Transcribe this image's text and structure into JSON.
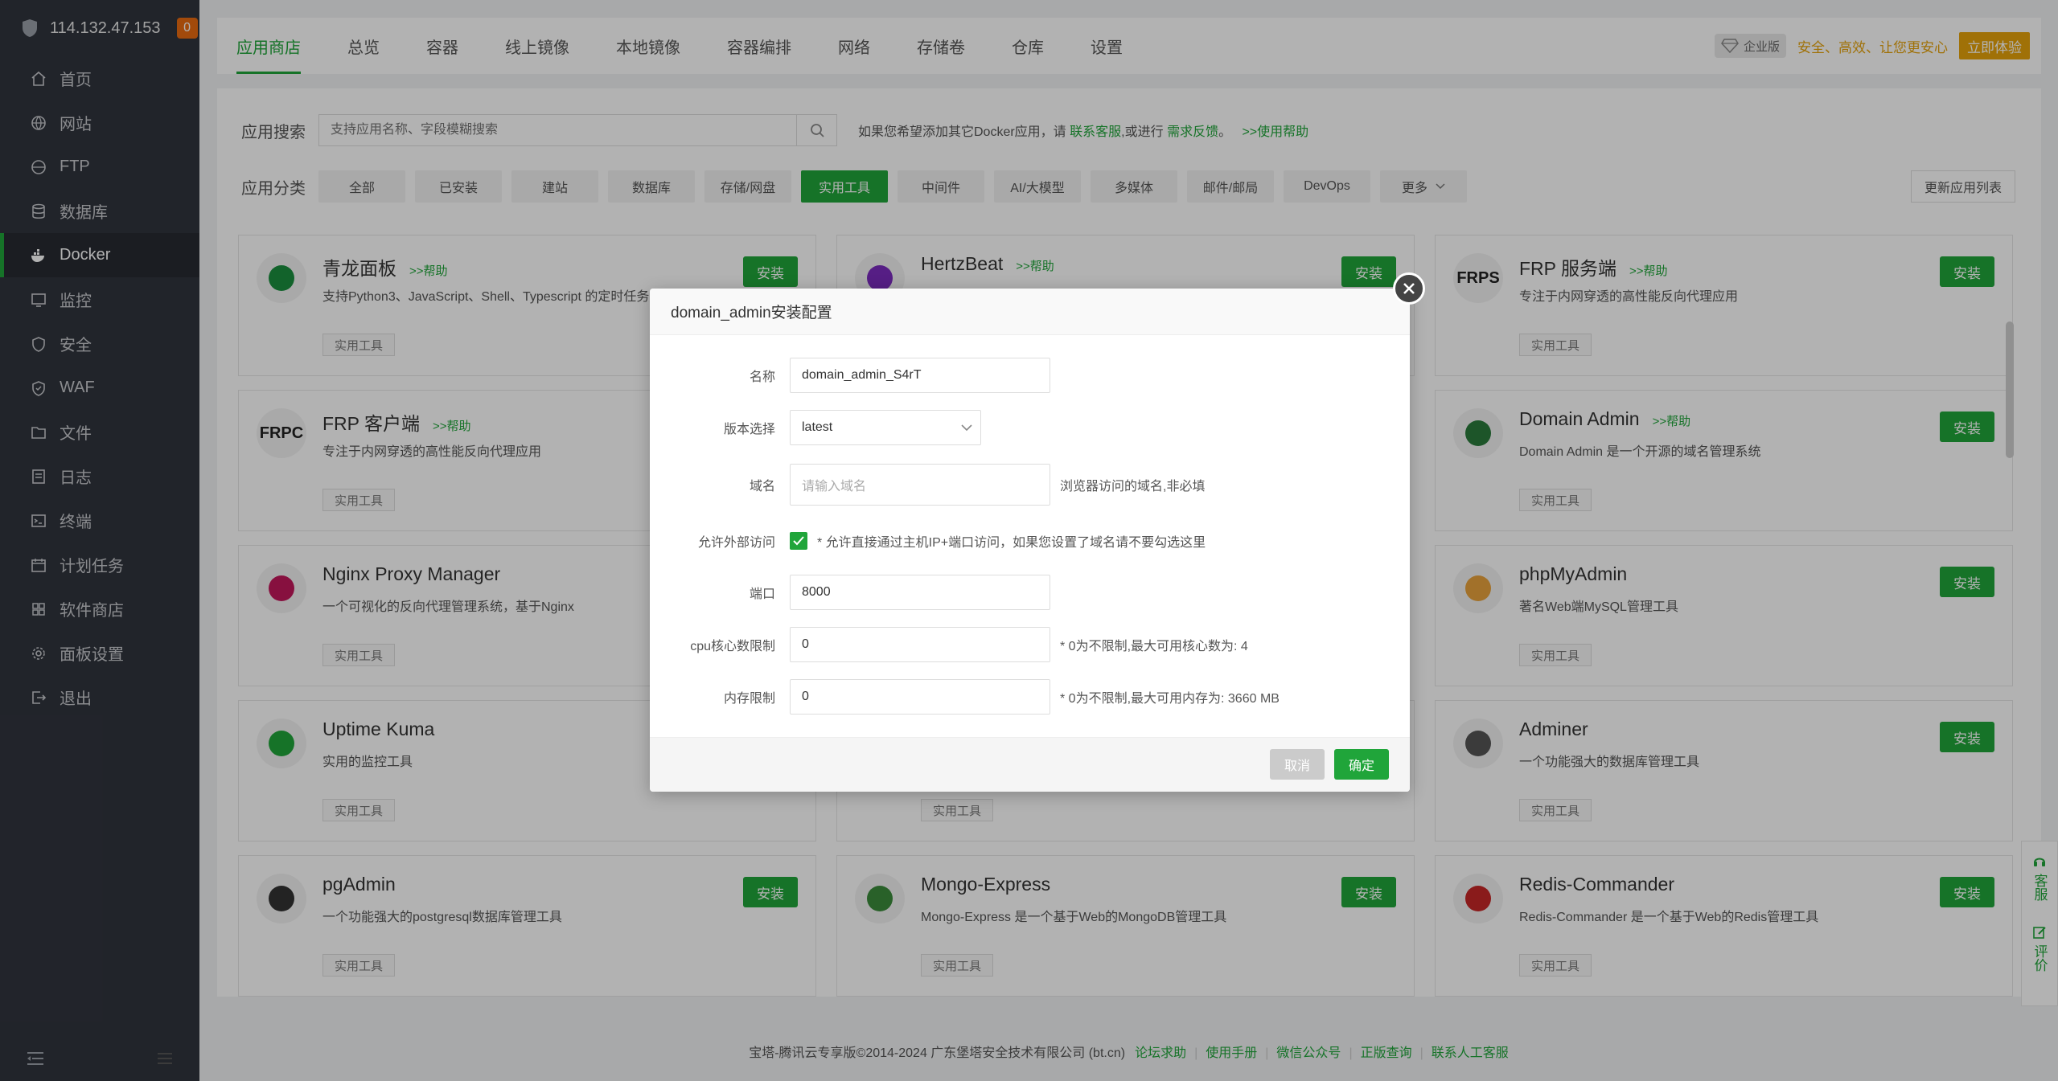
{
  "sidebar": {
    "ip": "114.132.47.153",
    "badge": "0",
    "items": [
      {
        "label": "首页",
        "icon": "home-icon"
      },
      {
        "label": "网站",
        "icon": "globe-icon"
      },
      {
        "label": "FTP",
        "icon": "ftp-icon"
      },
      {
        "label": "数据库",
        "icon": "database-icon"
      },
      {
        "label": "Docker",
        "icon": "docker-icon"
      },
      {
        "label": "监控",
        "icon": "monitor-icon"
      },
      {
        "label": "安全",
        "icon": "shield-icon"
      },
      {
        "label": "WAF",
        "icon": "waf-icon"
      },
      {
        "label": "文件",
        "icon": "folder-icon"
      },
      {
        "label": "日志",
        "icon": "log-icon"
      },
      {
        "label": "终端",
        "icon": "terminal-icon"
      },
      {
        "label": "计划任务",
        "icon": "calendar-icon"
      },
      {
        "label": "软件商店",
        "icon": "store-icon"
      },
      {
        "label": "面板设置",
        "icon": "gear-icon"
      },
      {
        "label": "退出",
        "icon": "logout-icon"
      }
    ]
  },
  "tabs": [
    "应用商店",
    "总览",
    "容器",
    "线上镜像",
    "本地镜像",
    "容器编排",
    "网络",
    "存储卷",
    "仓库",
    "设置"
  ],
  "enterprise": {
    "badge": "企业版",
    "text": "安全、高效、让您更安心",
    "button": "立即体验"
  },
  "search": {
    "label": "应用搜索",
    "placeholder": "支持应用名称、字段模糊搜索",
    "hint_pre": "如果您希望添加其它Docker应用，请",
    "hint_link1": "联系客服",
    "hint_mid": ",或进行",
    "hint_link2": "需求反馈",
    "hint_end": "。",
    "hint_help": ">>使用帮助"
  },
  "category": {
    "label": "应用分类",
    "items": [
      "全部",
      "已安装",
      "建站",
      "数据库",
      "存储/网盘",
      "实用工具",
      "中间件",
      "AI/大模型",
      "多媒体",
      "邮件/邮局",
      "DevOps",
      "更多"
    ],
    "refresh": "更新应用列表"
  },
  "apps": [
    {
      "title": "青龙面板",
      "help": ">>帮助",
      "desc": "支持Python3、JavaScript、Shell、Typescript 的定时任务",
      "tag": "实用工具",
      "logo": ""
    },
    {
      "title": "HertzBeat",
      "help": ">>帮助",
      "desc": "",
      "tag": "实用工具",
      "logo": ""
    },
    {
      "title": "FRP 服务端",
      "help": ">>帮助",
      "desc": "专注于内网穿透的高性能反向代理应用",
      "tag": "实用工具",
      "logo": "FRPS"
    },
    {
      "title": "FRP 客户端",
      "help": ">>帮助",
      "desc": "专注于内网穿透的高性能反向代理应用",
      "tag": "实用工具",
      "logo": "FRPC"
    },
    {
      "title": "Domain Admin",
      "help": ">>帮助",
      "desc": "Domain Admin 是一个开源的域名管理系统",
      "tag": "实用工具",
      "logo": ""
    },
    {
      "title": "Nginx Proxy Manager",
      "help": "",
      "desc": "一个可视化的反向代理管理系统，基于Nginx",
      "tag": "实用工具",
      "logo": ""
    },
    {
      "title": "phpMyAdmin",
      "help": "",
      "desc": "著名Web端MySQL管理工具",
      "tag": "实用工具",
      "logo": ""
    },
    {
      "title": "Uptime Kuma",
      "help": "",
      "desc": "实用的监控工具",
      "tag": "实用工具",
      "logo": ""
    },
    {
      "title": "",
      "help": "",
      "desc": "",
      "tag": "实用工具",
      "logo": ""
    },
    {
      "title": "Adminer",
      "help": "",
      "desc": "一个功能强大的数据库管理工具",
      "tag": "实用工具",
      "logo": ""
    },
    {
      "title": "pgAdmin",
      "help": "",
      "desc": "一个功能强大的postgresql数据库管理工具",
      "tag": "实用工具",
      "logo": ""
    },
    {
      "title": "Mongo-Express",
      "help": "",
      "desc": "Mongo-Express 是一个基于Web的MongoDB管理工具",
      "tag": "实用工具",
      "logo": ""
    },
    {
      "title": "Redis-Commander",
      "help": "",
      "desc": "Redis-Commander 是一个基于Web的Redis管理工具",
      "tag": "实用工具",
      "logo": ""
    }
  ],
  "install_label": "安装",
  "modal": {
    "title": "domain_admin安装配置",
    "name_label": "名称",
    "name_value": "domain_admin_S4rT",
    "version_label": "版本选择",
    "version_value": "latest",
    "domain_label": "域名",
    "domain_placeholder": "请输入域名",
    "domain_note": "浏览器访问的域名,非必填",
    "external_label": "允许外部访问",
    "external_note": "* 允许直接通过主机IP+端口访问，如果您设置了域名请不要勾选这里",
    "port_label": "端口",
    "port_value": "8000",
    "cpu_label": "cpu核心数限制",
    "cpu_value": "0",
    "cpu_note": "* 0为不限制,最大可用核心数为: 4",
    "mem_label": "内存限制",
    "mem_value": "0",
    "mem_note": "* 0为不限制,最大可用内存为: 3660 MB",
    "cancel": "取消",
    "ok": "确定"
  },
  "footer": {
    "copyright": "宝塔-腾讯云专享版©2014-2024 广东堡塔安全技术有限公司 (bt.cn)",
    "links": [
      "论坛求助",
      "使用手册",
      "微信公众号",
      "正版查询",
      "联系人工客服"
    ]
  },
  "float": {
    "service": "客服",
    "review": "评价"
  },
  "colors": {
    "accent": "#20a53a",
    "sidebar": "#30343d",
    "gold": "#e5a20b"
  }
}
